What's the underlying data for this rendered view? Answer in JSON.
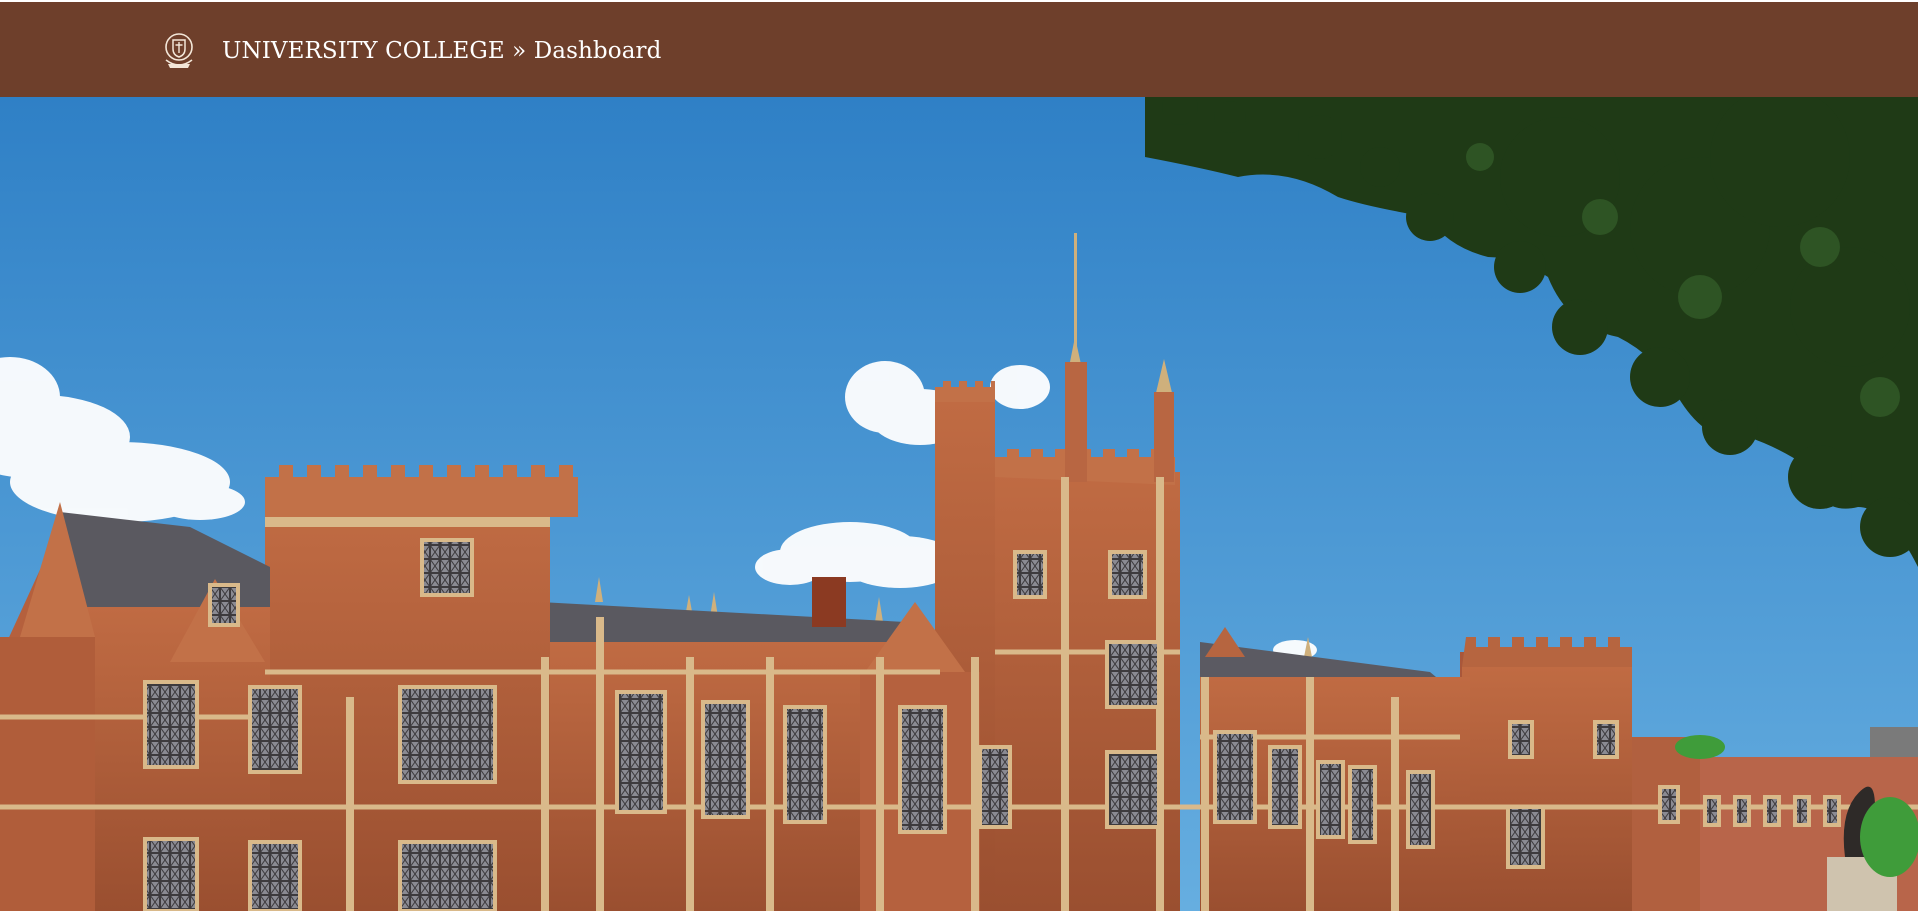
{
  "header": {
    "site_name": "UNIVERSITY COLLEGE",
    "separator": "»",
    "page_name": "Dashboard",
    "crest_icon": "university-crest-icon",
    "background_color": "#6e3f2b",
    "text_color": "#ffffff"
  },
  "hero": {
    "image_subject": "campus-building-photo",
    "sky_color": "#3f8fd0",
    "brick_color": "#b35f3c",
    "trim_color": "#d9b98a",
    "foliage_color": "#1f3a16"
  }
}
